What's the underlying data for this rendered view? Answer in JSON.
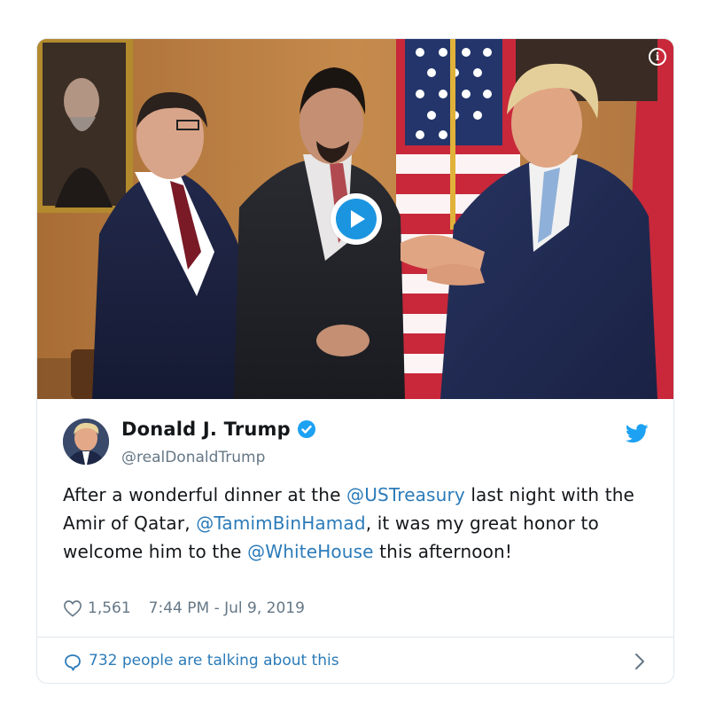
{
  "tweet": {
    "author_name": "Donald J. Trump",
    "handle": "@realDonaldTrump",
    "text_segments": [
      {
        "text": "After a wonderful dinner at the ",
        "type": "text"
      },
      {
        "text": "@USTreasury",
        "type": "mention"
      },
      {
        "text": " last night with the Amir of Qatar, ",
        "type": "text"
      },
      {
        "text": "@TamimBinHamad",
        "type": "mention"
      },
      {
        "text": ", it was my great honor to welcome him to the ",
        "type": "text"
      },
      {
        "text": "@WhiteHouse",
        "type": "mention"
      },
      {
        "text": " this afternoon!",
        "type": "text"
      }
    ],
    "likes": "1,561",
    "timestamp": "7:44 PM - Jul 9, 2019",
    "talking_about": "732 people are talking about this"
  },
  "media": {
    "type": "video",
    "info_icon": "info-icon",
    "play_icon": "play-icon"
  },
  "icons": {
    "verified": "verified-badge-icon",
    "platform": "twitter-bird-icon",
    "like": "heart-icon",
    "reply": "speech-bubble-icon",
    "chevron": "chevron-right-icon"
  },
  "colors": {
    "brand_blue": "#1da1f2",
    "link_blue": "#2b7bb9",
    "text": "#14171a",
    "muted": "#657786",
    "border": "#e1e8ed"
  }
}
